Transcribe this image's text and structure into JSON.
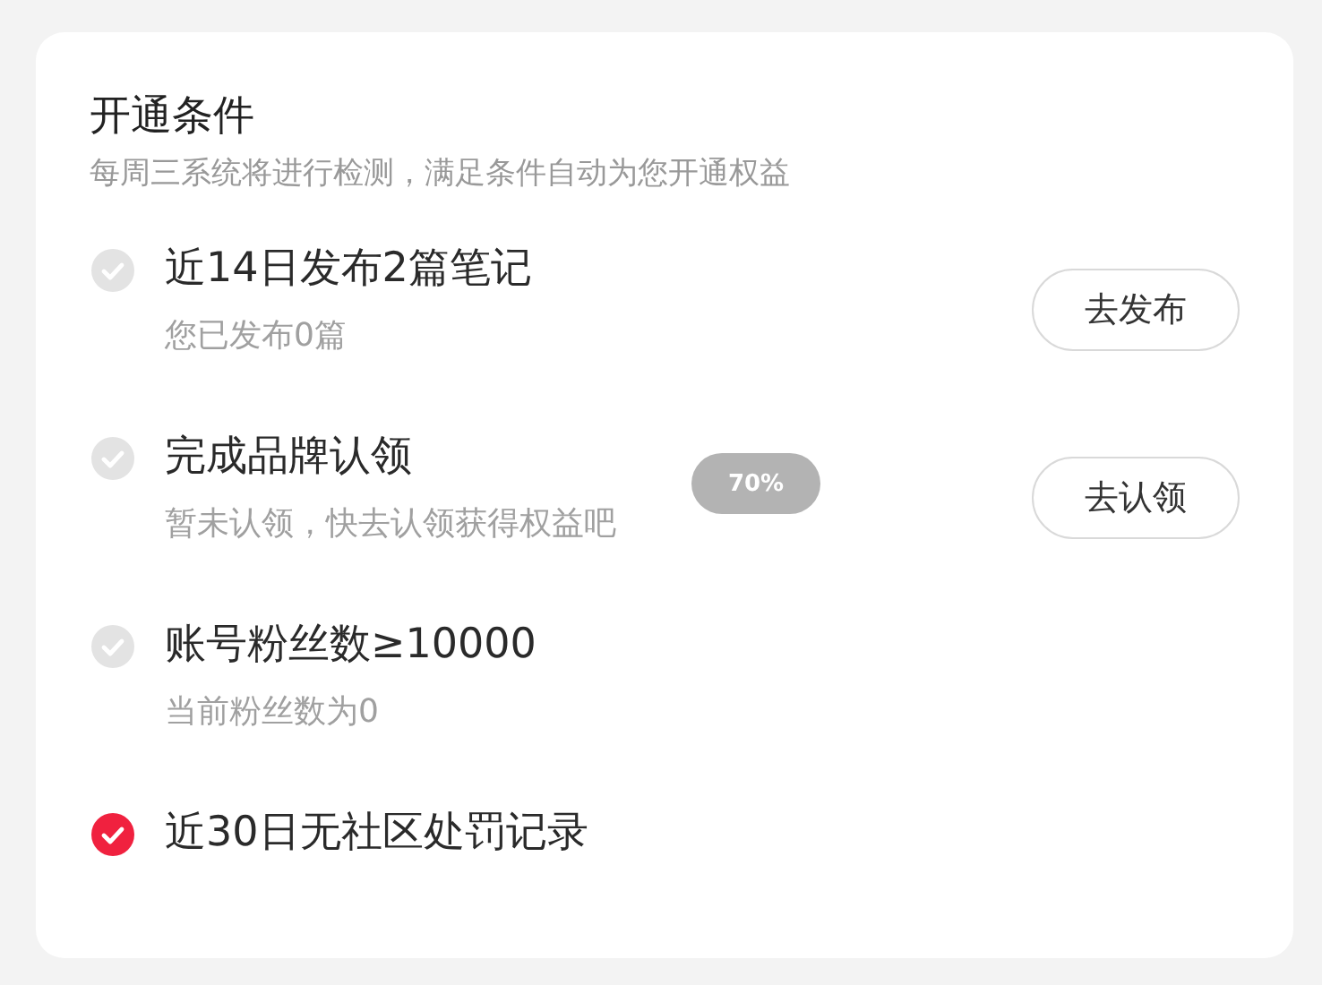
{
  "title": "开通条件",
  "subtitle": "每周三系统将进行检测，满足条件自动为您开通权益",
  "conditions": [
    {
      "title": "近14日发布2篇笔记",
      "detail": "您已发布0篇",
      "checked": false,
      "action": "去发布"
    },
    {
      "title": "完成品牌认领",
      "detail": "暂未认领，快去认领获得权益吧",
      "checked": false,
      "action": "去认领"
    },
    {
      "title": "账号粉丝数≥10000",
      "detail": "当前粉丝数为0",
      "checked": false
    },
    {
      "title": "近30日无社区处罚记录",
      "checked": true
    }
  ],
  "toast": {
    "text": "70%"
  }
}
